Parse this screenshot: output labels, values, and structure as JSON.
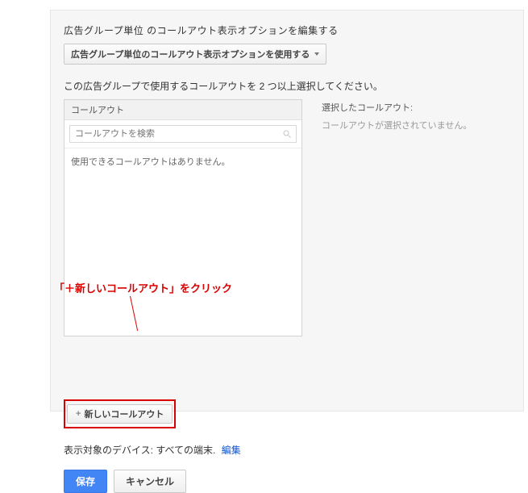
{
  "header": {
    "title": "広告グループ単位 のコールアウト表示オプションを編集する",
    "dropdown_label": "広告グループ単位のコールアウト表示オプションを使用する"
  },
  "instruction": "この広告グループで使用するコールアウトを 2 つ以上選択してください。",
  "left_list": {
    "header": "コールアウト",
    "search_placeholder": "コールアウトを検索",
    "empty_message": "使用できるコールアウトはありません。"
  },
  "right_list": {
    "title": "選択したコールアウト:",
    "empty_message": "コールアウトが選択されていません。"
  },
  "annotation": {
    "text": "「＋新しいコールアウト」をクリック"
  },
  "new_callout_button": "新しいコールアウト",
  "device_row": {
    "label": "表示対象のデバイス:",
    "value": "すべての端末.",
    "edit_link": "編集"
  },
  "buttons": {
    "save": "保存",
    "cancel": "キャンセル"
  }
}
